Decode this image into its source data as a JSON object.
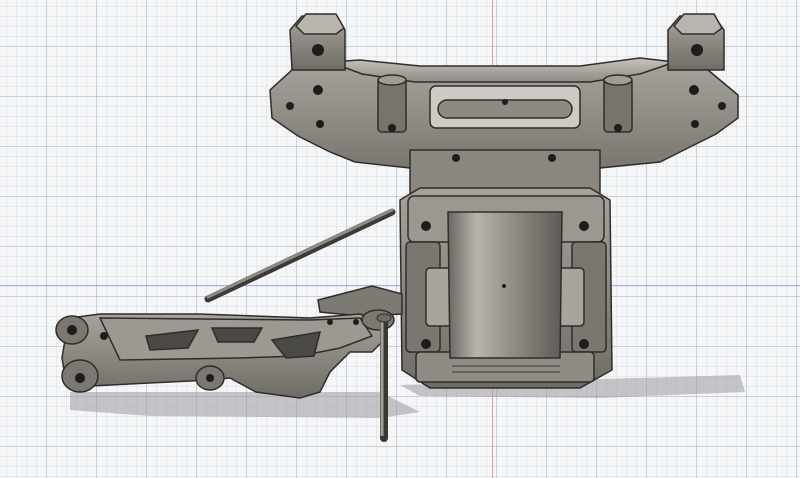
{
  "viewport": {
    "grid_colors": {
      "major": "#9aa0af",
      "minor": "#c6cad3",
      "background": "#f5f6f7"
    },
    "axis_colors": {
      "x_axis": "#5a64c8",
      "z_axis": "#dc5050"
    }
  },
  "model": {
    "colors": {
      "body": "#8a8680",
      "body_dark": "#5d5a55",
      "body_light": "#b3afa8",
      "edge": "#2f2d2a",
      "hole": "#1e1d1b",
      "shadow": "#9a9aa0"
    },
    "parts": [
      "shock-tower",
      "gearbox-housing",
      "differential-cup",
      "suspension-arm",
      "hinge-pin",
      "turnbuckle-rod"
    ]
  }
}
